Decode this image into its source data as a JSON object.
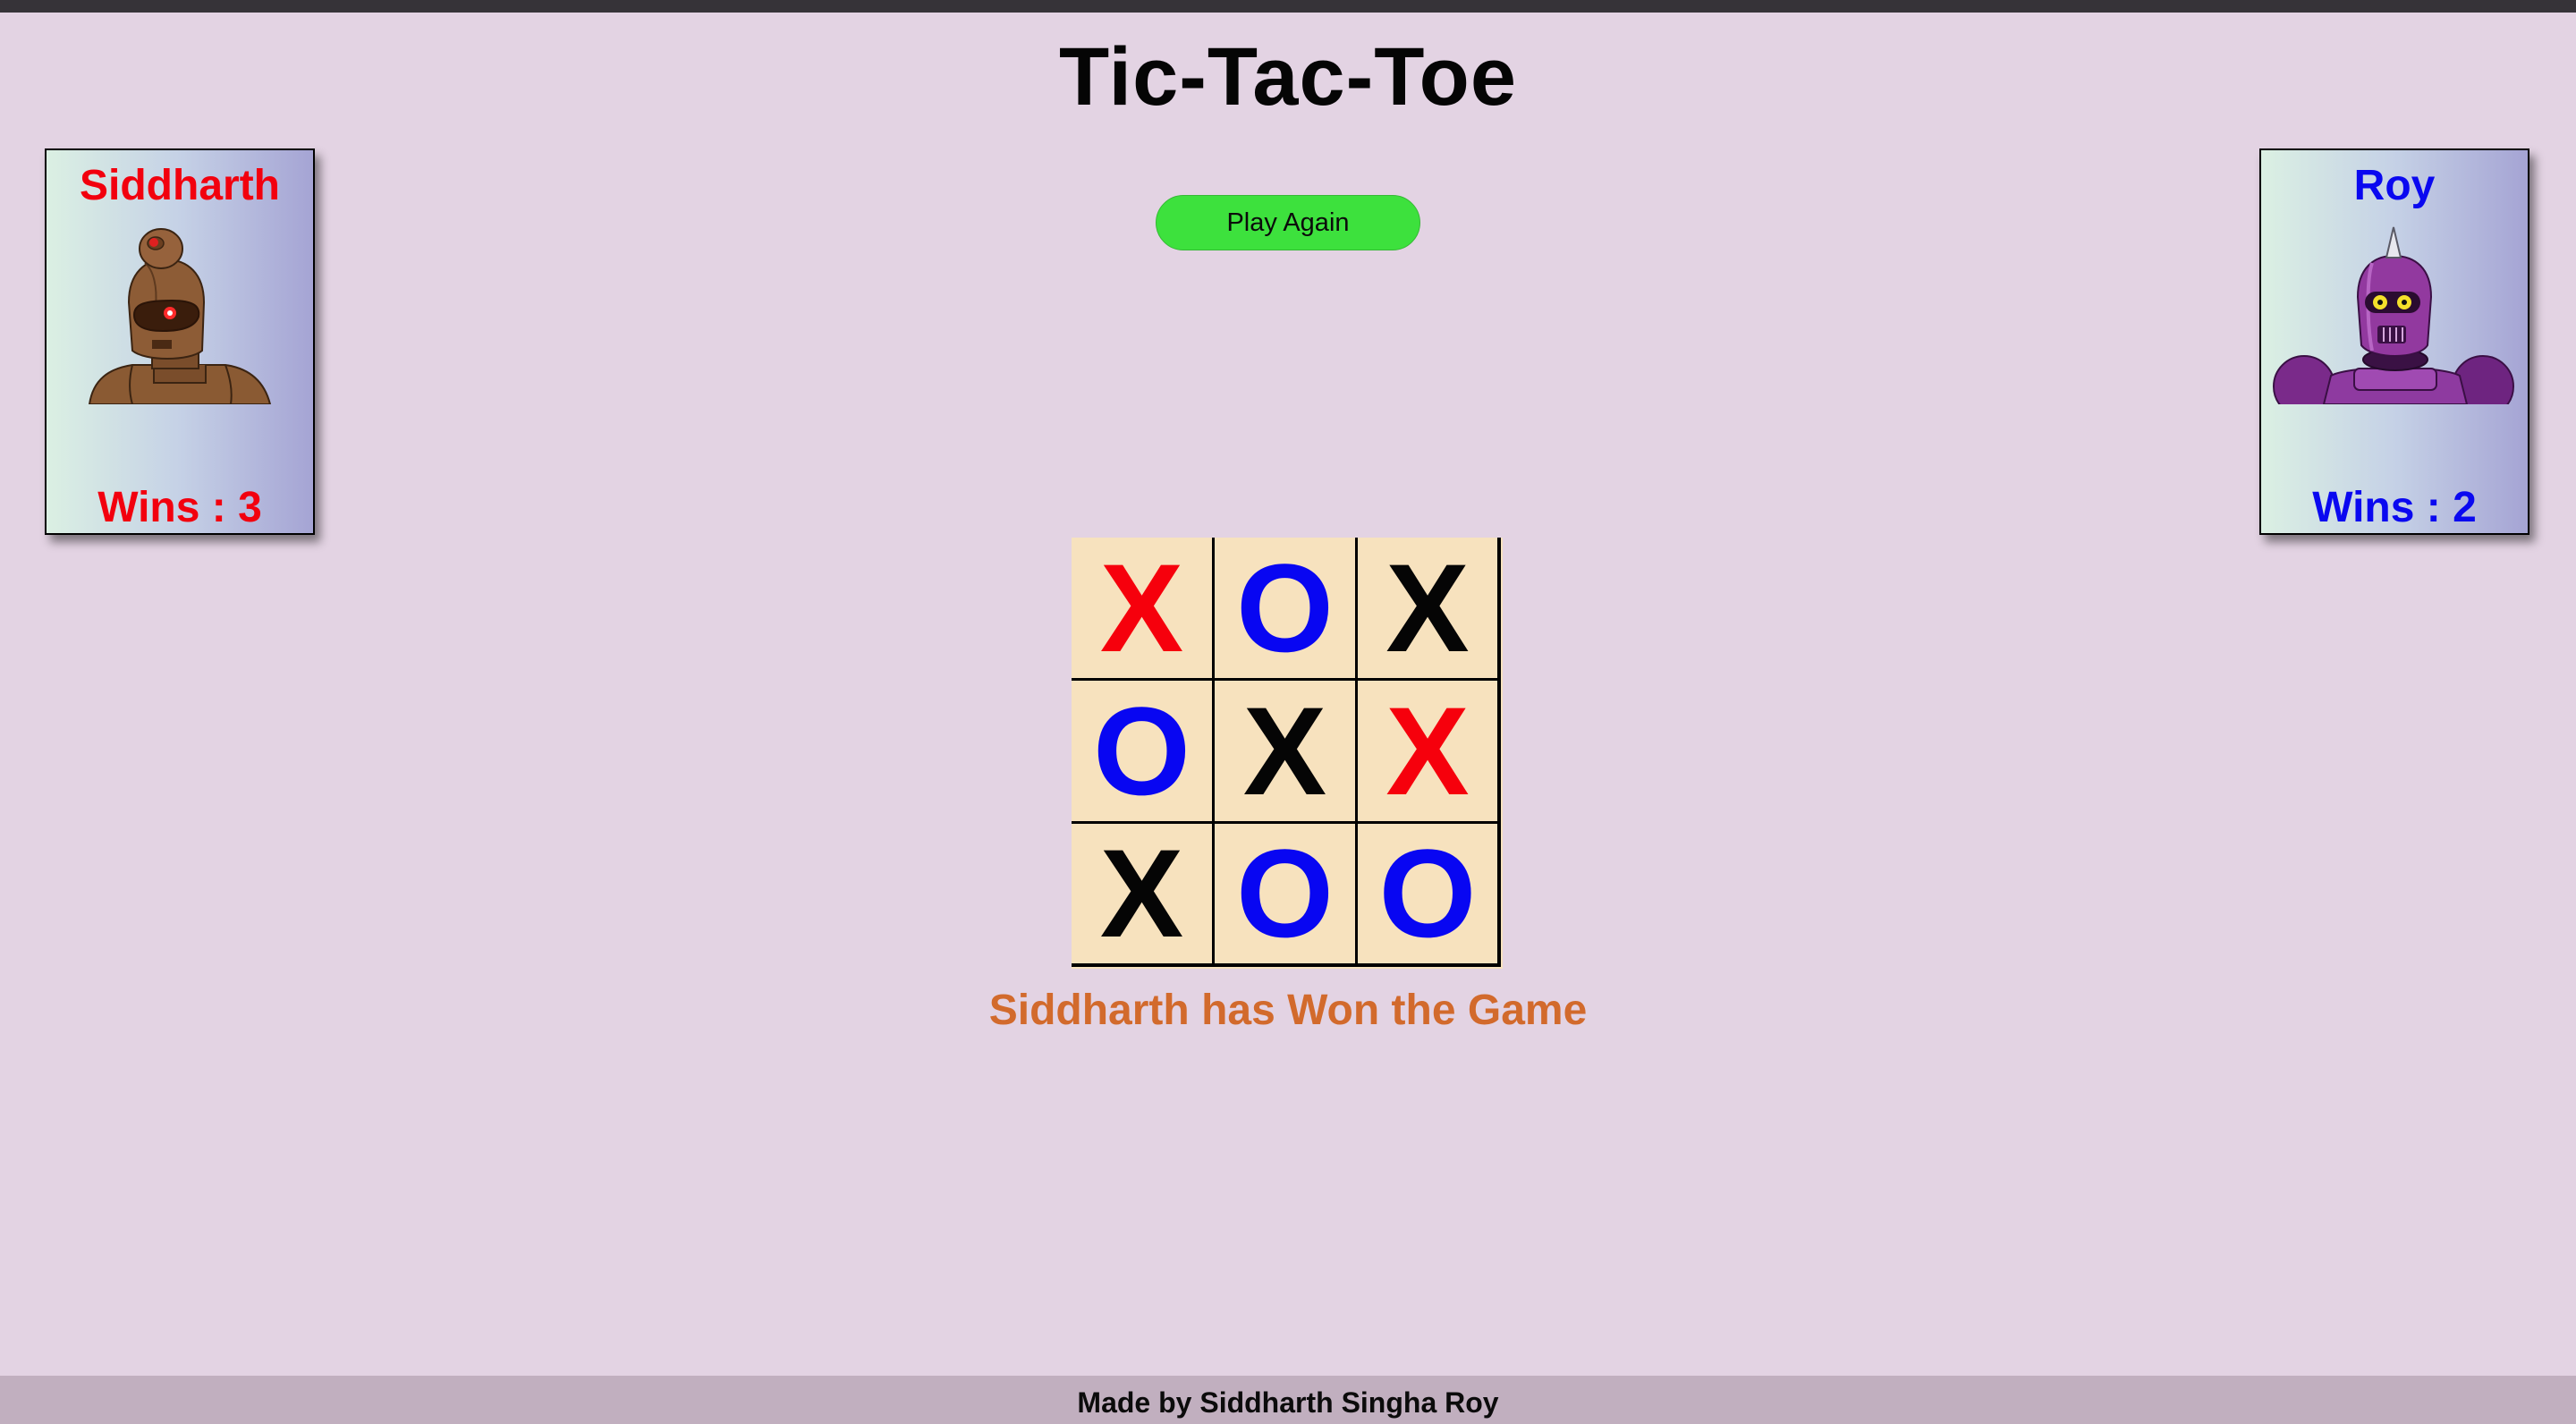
{
  "title": "Tic-Tac-Toe",
  "play_again_label": "Play Again",
  "players": [
    {
      "name": "Siddharth",
      "wins_label": "Wins : 3",
      "color": "#f2000e",
      "avatar": "brown-robot-avatar"
    },
    {
      "name": "Roy",
      "wins_label": "Wins : 2",
      "color": "#0a08f0",
      "avatar": "purple-robot-avatar"
    }
  ],
  "board": [
    [
      {
        "mark": "X",
        "color": "red"
      },
      {
        "mark": "O",
        "color": "blue"
      },
      {
        "mark": "X",
        "color": "black"
      }
    ],
    [
      {
        "mark": "O",
        "color": "blue"
      },
      {
        "mark": "X",
        "color": "black"
      },
      {
        "mark": "X",
        "color": "red"
      }
    ],
    [
      {
        "mark": "X",
        "color": "black"
      },
      {
        "mark": "O",
        "color": "blue"
      },
      {
        "mark": "O",
        "color": "blue"
      }
    ]
  ],
  "status": "Siddharth has Won the Game",
  "footer": "Made by Siddharth Singha Roy",
  "colors": {
    "background": "#e3d3e3",
    "board": "#f7e2be",
    "button": "#3de13d",
    "status": "#d26a2c",
    "footer": "#c1afbf"
  }
}
